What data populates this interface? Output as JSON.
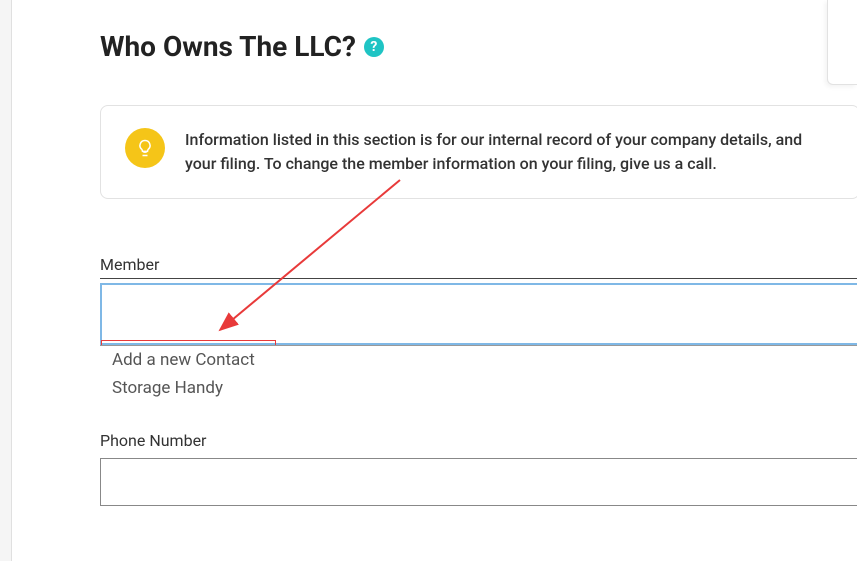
{
  "header": {
    "title": "Who Owns The LLC?"
  },
  "info": {
    "text": "Information listed in this section is for our internal record of your company details, and your filing. To change the member information on your filing, give us a call."
  },
  "fields": {
    "member": {
      "label": "Member",
      "options": [
        "Add a new Contact",
        "Storage Handy"
      ]
    },
    "phone": {
      "label": "Phone Number"
    }
  }
}
